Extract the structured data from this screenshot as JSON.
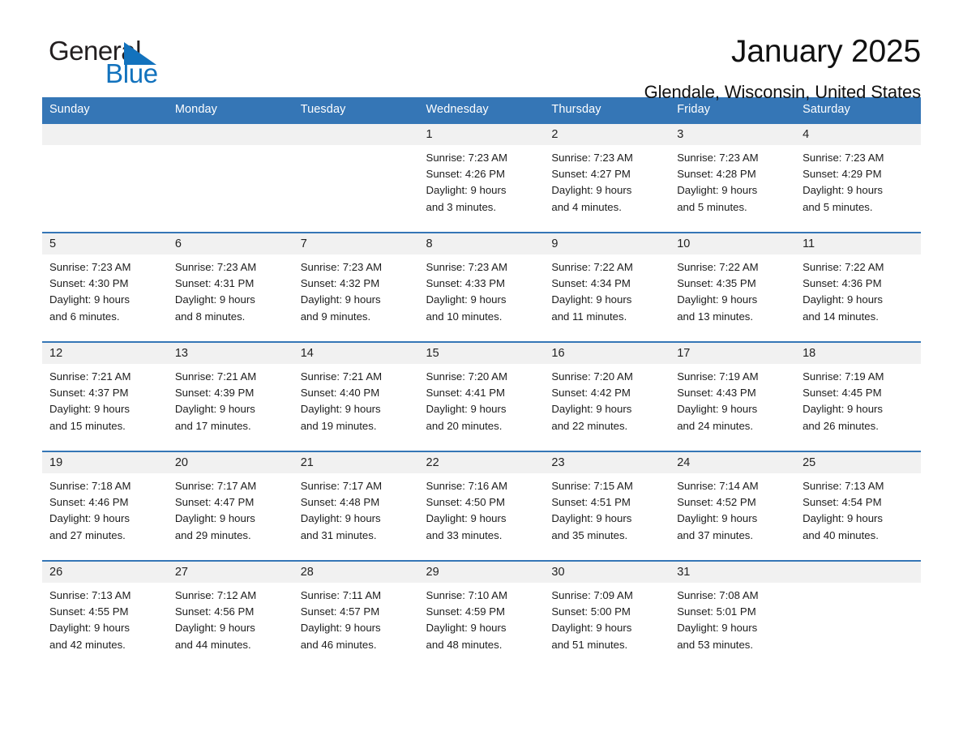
{
  "brand": {
    "name_part1": "General",
    "name_part2": "Blue",
    "triangle_color": "#1272bd"
  },
  "header": {
    "title": "January 2025",
    "location": "Glendale, Wisconsin, United States"
  },
  "theme": {
    "header_blue": "#3576b6",
    "row_band_gray": "#f1f1f1",
    "text_color": "#1d1d1d"
  },
  "weekday_headers": [
    "Sunday",
    "Monday",
    "Tuesday",
    "Wednesday",
    "Thursday",
    "Friday",
    "Saturday"
  ],
  "weeks": [
    [
      {
        "day": "",
        "empty": true
      },
      {
        "day": "",
        "empty": true
      },
      {
        "day": "",
        "empty": true
      },
      {
        "day": "1",
        "sunrise": "Sunrise: 7:23 AM",
        "sunset": "Sunset: 4:26 PM",
        "daylight_1": "Daylight: 9 hours",
        "daylight_2": "and 3 minutes."
      },
      {
        "day": "2",
        "sunrise": "Sunrise: 7:23 AM",
        "sunset": "Sunset: 4:27 PM",
        "daylight_1": "Daylight: 9 hours",
        "daylight_2": "and 4 minutes."
      },
      {
        "day": "3",
        "sunrise": "Sunrise: 7:23 AM",
        "sunset": "Sunset: 4:28 PM",
        "daylight_1": "Daylight: 9 hours",
        "daylight_2": "and 5 minutes."
      },
      {
        "day": "4",
        "sunrise": "Sunrise: 7:23 AM",
        "sunset": "Sunset: 4:29 PM",
        "daylight_1": "Daylight: 9 hours",
        "daylight_2": "and 5 minutes."
      }
    ],
    [
      {
        "day": "5",
        "sunrise": "Sunrise: 7:23 AM",
        "sunset": "Sunset: 4:30 PM",
        "daylight_1": "Daylight: 9 hours",
        "daylight_2": "and 6 minutes."
      },
      {
        "day": "6",
        "sunrise": "Sunrise: 7:23 AM",
        "sunset": "Sunset: 4:31 PM",
        "daylight_1": "Daylight: 9 hours",
        "daylight_2": "and 8 minutes."
      },
      {
        "day": "7",
        "sunrise": "Sunrise: 7:23 AM",
        "sunset": "Sunset: 4:32 PM",
        "daylight_1": "Daylight: 9 hours",
        "daylight_2": "and 9 minutes."
      },
      {
        "day": "8",
        "sunrise": "Sunrise: 7:23 AM",
        "sunset": "Sunset: 4:33 PM",
        "daylight_1": "Daylight: 9 hours",
        "daylight_2": "and 10 minutes."
      },
      {
        "day": "9",
        "sunrise": "Sunrise: 7:22 AM",
        "sunset": "Sunset: 4:34 PM",
        "daylight_1": "Daylight: 9 hours",
        "daylight_2": "and 11 minutes."
      },
      {
        "day": "10",
        "sunrise": "Sunrise: 7:22 AM",
        "sunset": "Sunset: 4:35 PM",
        "daylight_1": "Daylight: 9 hours",
        "daylight_2": "and 13 minutes."
      },
      {
        "day": "11",
        "sunrise": "Sunrise: 7:22 AM",
        "sunset": "Sunset: 4:36 PM",
        "daylight_1": "Daylight: 9 hours",
        "daylight_2": "and 14 minutes."
      }
    ],
    [
      {
        "day": "12",
        "sunrise": "Sunrise: 7:21 AM",
        "sunset": "Sunset: 4:37 PM",
        "daylight_1": "Daylight: 9 hours",
        "daylight_2": "and 15 minutes."
      },
      {
        "day": "13",
        "sunrise": "Sunrise: 7:21 AM",
        "sunset": "Sunset: 4:39 PM",
        "daylight_1": "Daylight: 9 hours",
        "daylight_2": "and 17 minutes."
      },
      {
        "day": "14",
        "sunrise": "Sunrise: 7:21 AM",
        "sunset": "Sunset: 4:40 PM",
        "daylight_1": "Daylight: 9 hours",
        "daylight_2": "and 19 minutes."
      },
      {
        "day": "15",
        "sunrise": "Sunrise: 7:20 AM",
        "sunset": "Sunset: 4:41 PM",
        "daylight_1": "Daylight: 9 hours",
        "daylight_2": "and 20 minutes."
      },
      {
        "day": "16",
        "sunrise": "Sunrise: 7:20 AM",
        "sunset": "Sunset: 4:42 PM",
        "daylight_1": "Daylight: 9 hours",
        "daylight_2": "and 22 minutes."
      },
      {
        "day": "17",
        "sunrise": "Sunrise: 7:19 AM",
        "sunset": "Sunset: 4:43 PM",
        "daylight_1": "Daylight: 9 hours",
        "daylight_2": "and 24 minutes."
      },
      {
        "day": "18",
        "sunrise": "Sunrise: 7:19 AM",
        "sunset": "Sunset: 4:45 PM",
        "daylight_1": "Daylight: 9 hours",
        "daylight_2": "and 26 minutes."
      }
    ],
    [
      {
        "day": "19",
        "sunrise": "Sunrise: 7:18 AM",
        "sunset": "Sunset: 4:46 PM",
        "daylight_1": "Daylight: 9 hours",
        "daylight_2": "and 27 minutes."
      },
      {
        "day": "20",
        "sunrise": "Sunrise: 7:17 AM",
        "sunset": "Sunset: 4:47 PM",
        "daylight_1": "Daylight: 9 hours",
        "daylight_2": "and 29 minutes."
      },
      {
        "day": "21",
        "sunrise": "Sunrise: 7:17 AM",
        "sunset": "Sunset: 4:48 PM",
        "daylight_1": "Daylight: 9 hours",
        "daylight_2": "and 31 minutes."
      },
      {
        "day": "22",
        "sunrise": "Sunrise: 7:16 AM",
        "sunset": "Sunset: 4:50 PM",
        "daylight_1": "Daylight: 9 hours",
        "daylight_2": "and 33 minutes."
      },
      {
        "day": "23",
        "sunrise": "Sunrise: 7:15 AM",
        "sunset": "Sunset: 4:51 PM",
        "daylight_1": "Daylight: 9 hours",
        "daylight_2": "and 35 minutes."
      },
      {
        "day": "24",
        "sunrise": "Sunrise: 7:14 AM",
        "sunset": "Sunset: 4:52 PM",
        "daylight_1": "Daylight: 9 hours",
        "daylight_2": "and 37 minutes."
      },
      {
        "day": "25",
        "sunrise": "Sunrise: 7:13 AM",
        "sunset": "Sunset: 4:54 PM",
        "daylight_1": "Daylight: 9 hours",
        "daylight_2": "and 40 minutes."
      }
    ],
    [
      {
        "day": "26",
        "sunrise": "Sunrise: 7:13 AM",
        "sunset": "Sunset: 4:55 PM",
        "daylight_1": "Daylight: 9 hours",
        "daylight_2": "and 42 minutes."
      },
      {
        "day": "27",
        "sunrise": "Sunrise: 7:12 AM",
        "sunset": "Sunset: 4:56 PM",
        "daylight_1": "Daylight: 9 hours",
        "daylight_2": "and 44 minutes."
      },
      {
        "day": "28",
        "sunrise": "Sunrise: 7:11 AM",
        "sunset": "Sunset: 4:57 PM",
        "daylight_1": "Daylight: 9 hours",
        "daylight_2": "and 46 minutes."
      },
      {
        "day": "29",
        "sunrise": "Sunrise: 7:10 AM",
        "sunset": "Sunset: 4:59 PM",
        "daylight_1": "Daylight: 9 hours",
        "daylight_2": "and 48 minutes."
      },
      {
        "day": "30",
        "sunrise": "Sunrise: 7:09 AM",
        "sunset": "Sunset: 5:00 PM",
        "daylight_1": "Daylight: 9 hours",
        "daylight_2": "and 51 minutes."
      },
      {
        "day": "31",
        "sunrise": "Sunrise: 7:08 AM",
        "sunset": "Sunset: 5:01 PM",
        "daylight_1": "Daylight: 9 hours",
        "daylight_2": "and 53 minutes."
      },
      {
        "day": "",
        "empty": true
      }
    ]
  ]
}
